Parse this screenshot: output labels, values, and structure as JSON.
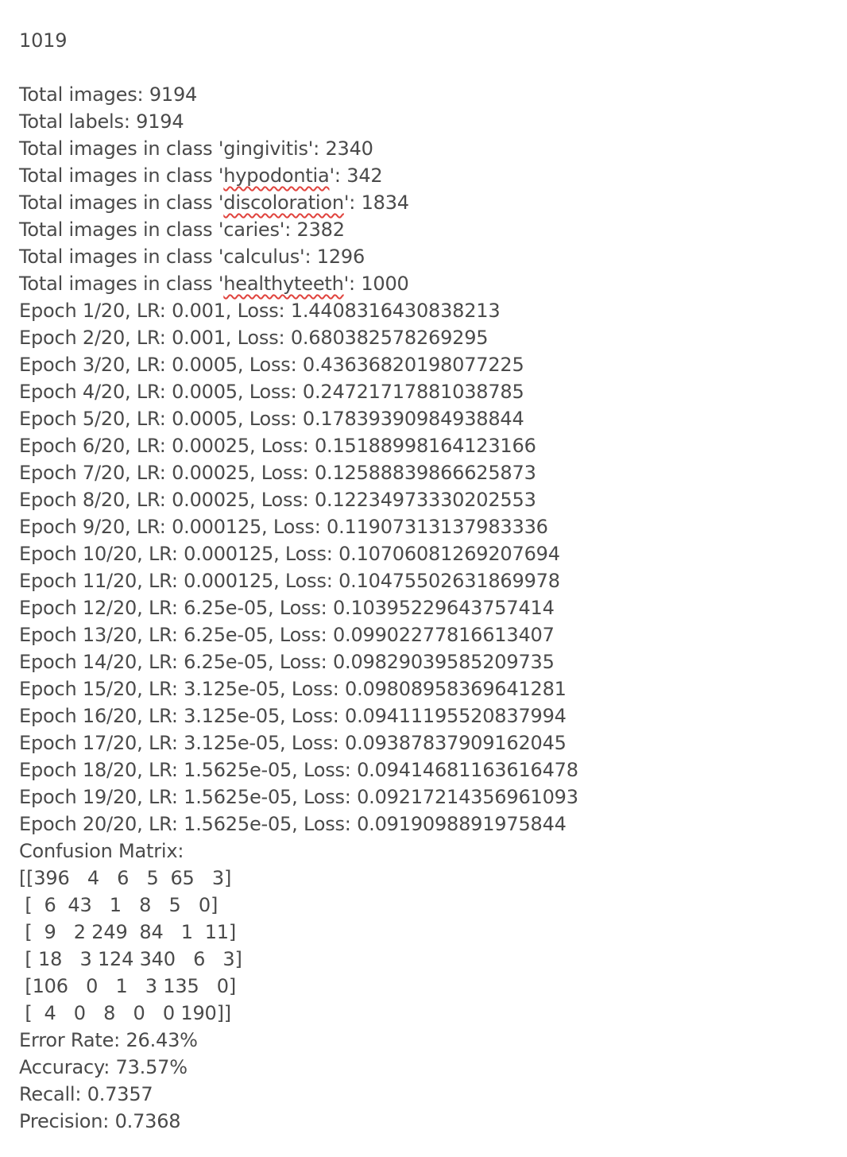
{
  "note": {
    "header": "1019",
    "totals": {
      "images": "Total images: 9194",
      "labels": "Total labels: 9194"
    },
    "class_lines": [
      {
        "prefix": "Total images in class '",
        "name": "gingivitis",
        "suffix": "': 2340",
        "misspelled": false
      },
      {
        "prefix": "Total images in class '",
        "name": "hypodontia",
        "suffix": "': 342",
        "misspelled": true
      },
      {
        "prefix": "Total images in class '",
        "name": "discoloration",
        "suffix": "': 1834",
        "misspelled": true
      },
      {
        "prefix": "Total images in class '",
        "name": "caries",
        "suffix": "': 2382",
        "misspelled": false
      },
      {
        "prefix": "Total images in class '",
        "name": "calculus",
        "suffix": "': 1296",
        "misspelled": false
      },
      {
        "prefix": "Total images in class '",
        "name": "healthyteeth",
        "suffix": "': 1000",
        "misspelled": true
      }
    ],
    "epochs": [
      "Epoch 1/20, LR: 0.001, Loss: 1.4408316430838213",
      "Epoch 2/20, LR: 0.001, Loss: 0.680382578269295",
      "Epoch 3/20, LR: 0.0005, Loss: 0.43636820198077225",
      "Epoch 4/20, LR: 0.0005, Loss: 0.24721717881038785",
      "Epoch 5/20, LR: 0.0005, Loss: 0.17839390984938844",
      "Epoch 6/20, LR: 0.00025, Loss: 0.15188998164123166",
      "Epoch 7/20, LR: 0.00025, Loss: 0.12588839866625873",
      "Epoch 8/20, LR: 0.00025, Loss: 0.12234973330202553",
      "Epoch 9/20, LR: 0.000125, Loss: 0.11907313137983336",
      "Epoch 10/20, LR: 0.000125, Loss: 0.10706081269207694",
      "Epoch 11/20, LR: 0.000125, Loss: 0.10475502631869978",
      "Epoch 12/20, LR: 6.25e-05, Loss: 0.10395229643757414",
      "Epoch 13/20, LR: 6.25e-05, Loss: 0.09902277816613407",
      "Epoch 14/20, LR: 6.25e-05, Loss: 0.09829039585209735",
      "Epoch 15/20, LR: 3.125e-05, Loss: 0.09808958369641281",
      "Epoch 16/20, LR: 3.125e-05, Loss: 0.09411195520837994",
      "Epoch 17/20, LR: 3.125e-05, Loss: 0.09387837909162045",
      "Epoch 18/20, LR: 1.5625e-05, Loss: 0.09414681163616478",
      "Epoch 19/20, LR: 1.5625e-05, Loss: 0.09217214356961093",
      "Epoch 20/20, LR: 1.5625e-05, Loss: 0.0919098891975844"
    ],
    "confusion_title": "Confusion Matrix:",
    "confusion_rows": [
      "[[396   4   6   5  65   3]",
      " [  6  43   1   8   5   0]",
      " [  9   2 249  84   1  11]",
      " [ 18   3 124 340   6   3]",
      " [106   0   1   3 135   0]",
      " [  4   0   8   0   0 190]]"
    ],
    "metrics": {
      "error_rate": "Error Rate: 26.43%",
      "accuracy": "Accuracy: 73.57%",
      "recall": "Recall: 0.7357",
      "precision": "Precision: 0.7368"
    },
    "colors": {
      "text": "#4a4a4a",
      "spellcheck_underline": "#e0433d",
      "background": "#ffffff"
    }
  }
}
